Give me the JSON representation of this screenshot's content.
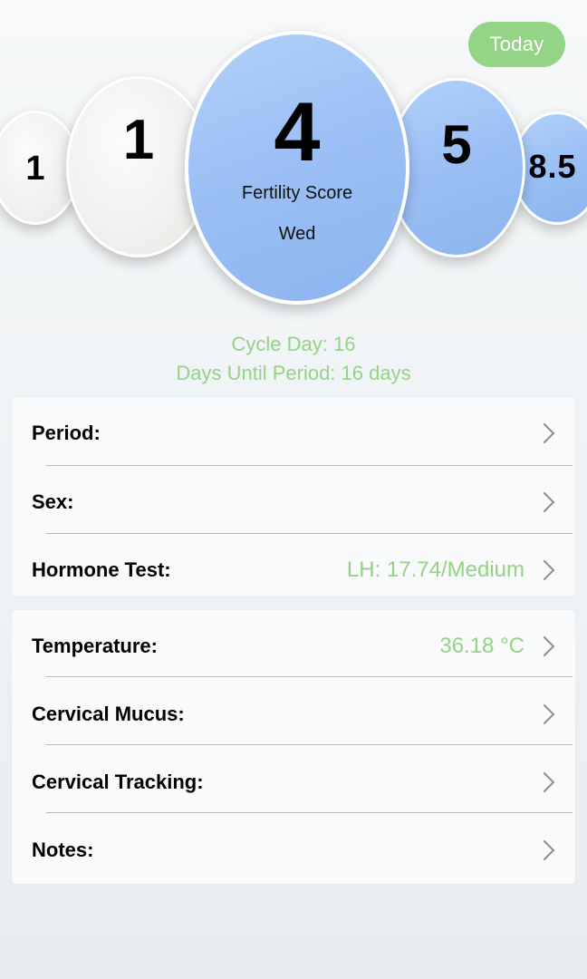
{
  "header": {
    "today_label": "Today"
  },
  "bubbles": [
    {
      "value": "1"
    },
    {
      "value": "1"
    },
    {
      "value": "4",
      "label": "Fertility Score",
      "day": "Wed"
    },
    {
      "value": "5"
    },
    {
      "value": "8.5"
    }
  ],
  "cycle": {
    "day_text": "Cycle Day: 16",
    "until_period_text": "Days Until Period: 16 days"
  },
  "cards": {
    "group1": [
      {
        "label": "Period:",
        "value": ""
      },
      {
        "label": "Sex:",
        "value": ""
      },
      {
        "label": "Hormone Test:",
        "value": "LH: 17.74/Medium"
      }
    ],
    "group2": [
      {
        "label": "Temperature:",
        "value": "36.18 °C"
      },
      {
        "label": "Cervical Mucus:",
        "value": ""
      },
      {
        "label": "Cervical Tracking:",
        "value": ""
      },
      {
        "label": "Notes:",
        "value": ""
      }
    ]
  },
  "colors": {
    "accent_green": "#95d186",
    "today_button": "#93d486",
    "bubble_blue": "#9cc0f5",
    "bubble_gray": "#f1f1ef"
  },
  "icons": {
    "row_chevron": "chevron-right-icon"
  }
}
